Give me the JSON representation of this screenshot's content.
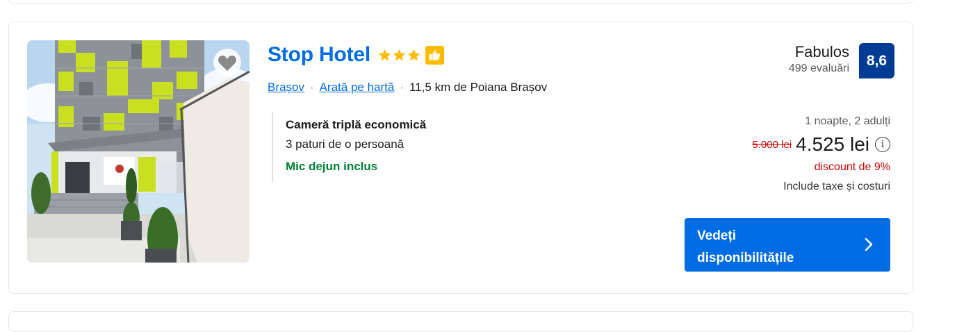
{
  "hotel": {
    "name": "Stop Hotel",
    "stars": 3,
    "location": "Brașov",
    "map_link": "Arată pe hartă",
    "distance": "11,5 km de Poiana Brașov"
  },
  "room": {
    "name": "Cameră triplă economică",
    "beds": "3 paturi de o persoană",
    "breakfast": "Mic dejun inclus"
  },
  "review": {
    "word": "Fabulos",
    "count": "499 evaluări",
    "score": "8,6"
  },
  "price": {
    "stay": "1 noapte, 2 adulți",
    "old": "5.000 lei",
    "new": "4.525 lei",
    "discount": "discount de 9%",
    "taxes": "Include taxe și costuri"
  },
  "cta": {
    "label_line1": "Vedeți",
    "label_line2": "disponibilitățile"
  },
  "icons": {
    "favorite": "heart-icon",
    "info": "info-icon",
    "chevron": "chevron-right-icon",
    "preferred": "thumbs-up-icon"
  },
  "colors": {
    "link": "#006ce4",
    "score_bg": "#003b95",
    "star": "#febb02",
    "breakfast": "#008234",
    "discount": "#cc0000"
  }
}
